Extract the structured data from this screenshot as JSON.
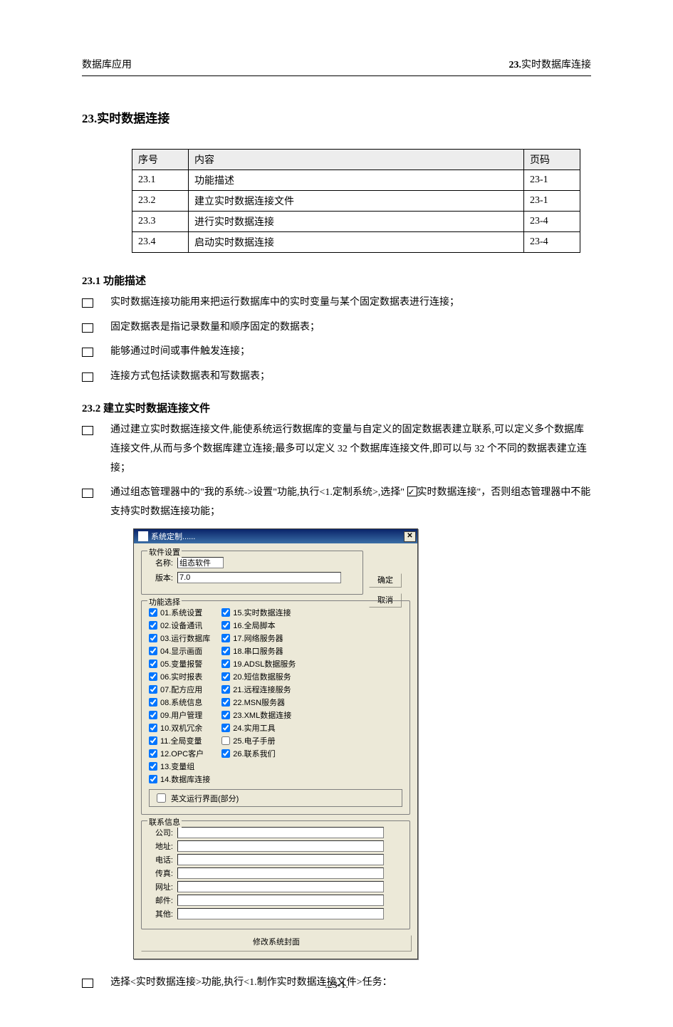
{
  "header": {
    "left": "数据库应用",
    "right_num": "23.",
    "right_text": "实时数据库连接"
  },
  "chapter": {
    "num": "23.",
    "title": "实时数据连接"
  },
  "toc": {
    "headers": [
      "序号",
      "内容",
      "页码"
    ],
    "rows": [
      {
        "num": "23.1",
        "title": "功能描述",
        "page": "23-1"
      },
      {
        "num": "23.2",
        "title": "建立实时数据连接文件",
        "page": "23-1"
      },
      {
        "num": "23.3",
        "title": "进行实时数据连接",
        "page": "23-4"
      },
      {
        "num": "23.4",
        "title": "启动实时数据连接",
        "page": "23-4"
      }
    ]
  },
  "sec1": {
    "heading_num": "23.1 ",
    "heading_title": "功能描述",
    "bullets": [
      "实时数据连接功能用来把运行数据库中的实时变量与某个固定数据表进行连接；",
      "固定数据表是指记录数量和顺序固定的数据表；",
      "能够通过时间或事件触发连接；",
      "连接方式包括读数据表和写数据表；"
    ]
  },
  "sec2": {
    "heading_num": "23.2 ",
    "heading_title": "建立实时数据连接文件",
    "bullet1": "通过建立实时数据连接文件,能使系统运行数据库的变量与自定义的固定数据表建立联系,可以定义多个数据库连接文件,从而与多个数据库建立连接;最多可以定义 32 个数据库连接文件,即可以与 32 个不同的数据表建立连接；",
    "bullet2_a": "通过组态管理器中的\"我的系统->设置\"功能,执行<1.定制系统>,选择\" ",
    "bullet2_b": "实时数据连接\"，否则组态管理器中不能支持实时数据连接功能；",
    "bullet3": "选择<实时数据连接>功能,执行<1.制作实时数据连接文件>任务："
  },
  "dialog": {
    "title": "系统定制......",
    "btn_ok": "确定",
    "btn_cancel": "取消",
    "group_software": "软件设置",
    "label_name": "名称:",
    "value_name": "组态软件",
    "label_ver": "版本:",
    "value_ver": "7.0",
    "group_features": "功能选择",
    "features_left": [
      "01.系统设置",
      "02.设备通讯",
      "03.运行数据库",
      "04.显示画面",
      "05.变量报警",
      "06.实时报表",
      "07.配方应用",
      "08.系统信息",
      "09.用户管理",
      "10.双机冗余",
      "11.全局变量",
      "12.OPC客户",
      "13.变量组",
      "14.数据库连接"
    ],
    "features_right": [
      "15.实时数据连接",
      "16.全局脚本",
      "17.网络服务器",
      "18.串口服务器",
      "19.ADSL数据服务",
      "20.短信数据服务",
      "21.远程连接服务",
      "22.MSN服务器",
      "23.XML数据连接",
      "24.实用工具",
      "25.电子手册",
      "26.联系我们"
    ],
    "english_ui": "英文运行界面(部分)",
    "group_contact": "联系信息",
    "contact_labels": [
      "公司:",
      "地址:",
      "电话:",
      "传真:",
      "网址:",
      "邮件:",
      "其他:"
    ],
    "btn_wide": "修改系统封面"
  },
  "footer": ".23-1."
}
